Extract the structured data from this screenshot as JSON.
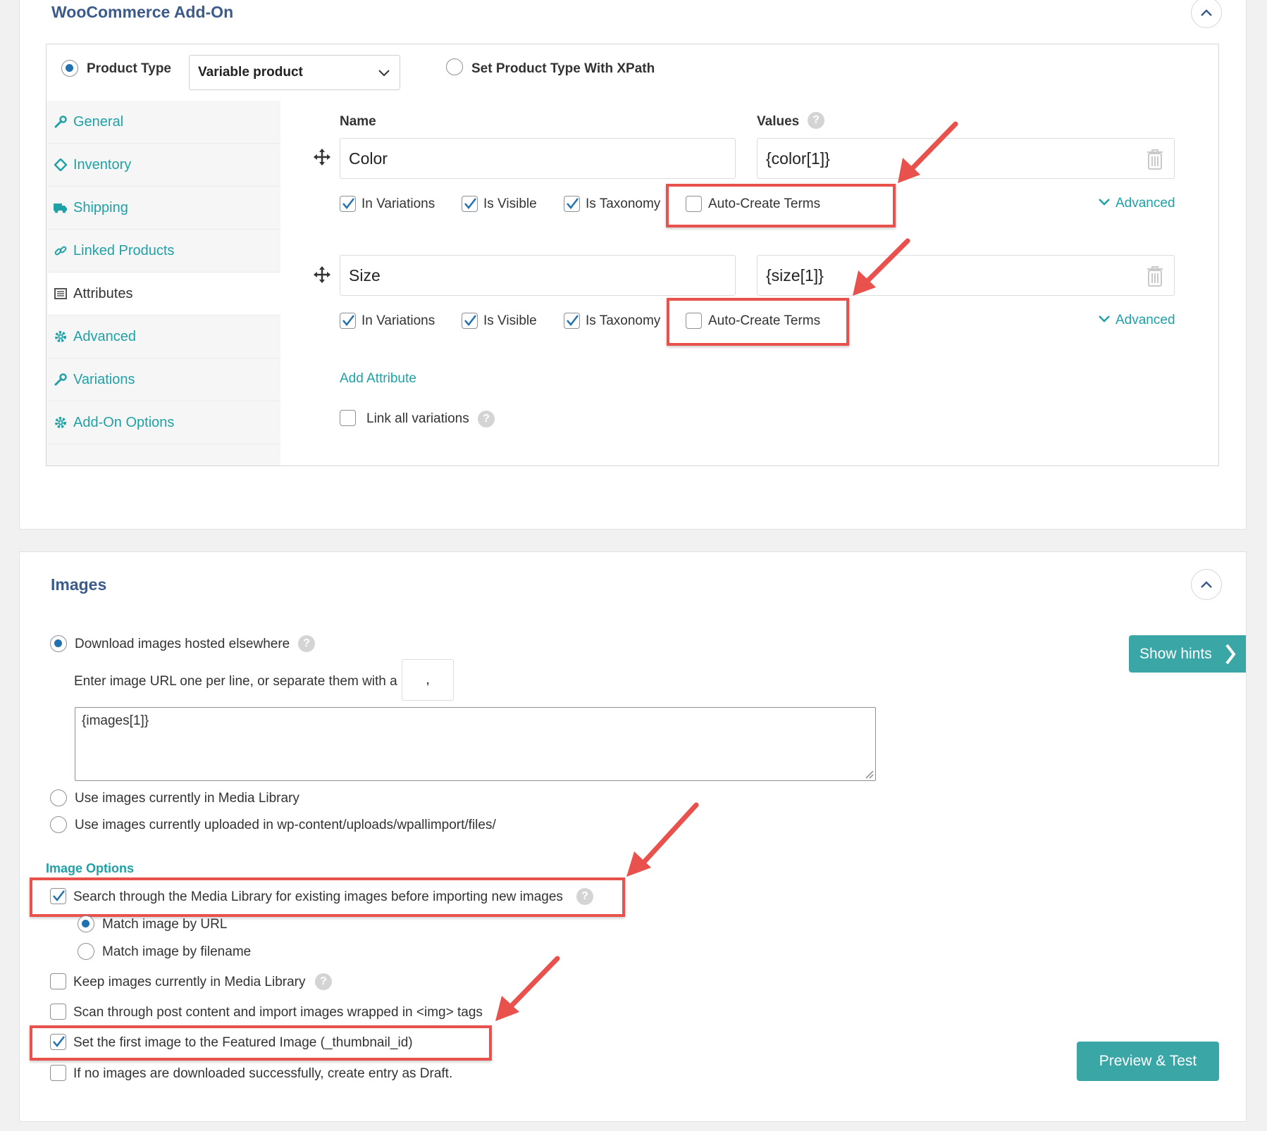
{
  "woo": {
    "title": "WooCommerce Add-On",
    "product_type_label": "Product Type",
    "product_type_value": "Variable product",
    "xpath_label": "Set Product Type With XPath",
    "tabs": [
      {
        "label": "General",
        "icon": "wrench-icon"
      },
      {
        "label": "Inventory",
        "icon": "tag-icon"
      },
      {
        "label": "Shipping",
        "icon": "truck-icon"
      },
      {
        "label": "Linked Products",
        "icon": "link-icon"
      },
      {
        "label": "Attributes",
        "icon": "list-icon"
      },
      {
        "label": "Advanced",
        "icon": "gear-icon"
      },
      {
        "label": "Variations",
        "icon": "wrench-icon"
      },
      {
        "label": "Add-On Options",
        "icon": "gear-icon"
      }
    ],
    "name_header": "Name",
    "values_header": "Values",
    "attributes": [
      {
        "name": "Color",
        "value": "{color[1]}",
        "in_variations": "In Variations",
        "is_visible": "Is Visible",
        "is_taxonomy": "Is Taxonomy",
        "auto_create": "Auto-Create Terms",
        "advanced": "Advanced"
      },
      {
        "name": "Size",
        "value": "{size[1]}",
        "in_variations": "In Variations",
        "is_visible": "Is Visible",
        "is_taxonomy": "Is Taxonomy",
        "auto_create": "Auto-Create Terms",
        "advanced": "Advanced"
      }
    ],
    "add_attribute": "Add Attribute",
    "link_all_variations": "Link all variations"
  },
  "images": {
    "title": "Images",
    "download_label": "Download images hosted elsewhere",
    "url_instruction": "Enter image URL one per line, or separate them with a",
    "separator_value": ",",
    "urls_value": "{images[1]}",
    "media_library_label": "Use images currently in Media Library",
    "uploaded_label": "Use images currently uploaded in wp-content/uploads/wpallimport/files/",
    "options_heading": "Image Options",
    "search_label": "Search through the Media Library for existing images before importing new images",
    "match_url_label": "Match image by URL",
    "match_filename_label": "Match image by filename",
    "keep_label": "Keep images currently in Media Library",
    "scan_label": "Scan through post content and import images wrapped in <img> tags",
    "featured_label": "Set the first image to the Featured Image (_thumbnail_id)",
    "draft_label": "If no images are downloaded successfully, create entry as Draft.",
    "show_hints": "Show hints",
    "preview_test": "Preview & Test"
  },
  "colors": {
    "accent_teal": "#1fa1a6",
    "button_teal": "#3aa6a6",
    "title_blue": "#3c5b8a",
    "annotation_red": "#e9514c"
  }
}
